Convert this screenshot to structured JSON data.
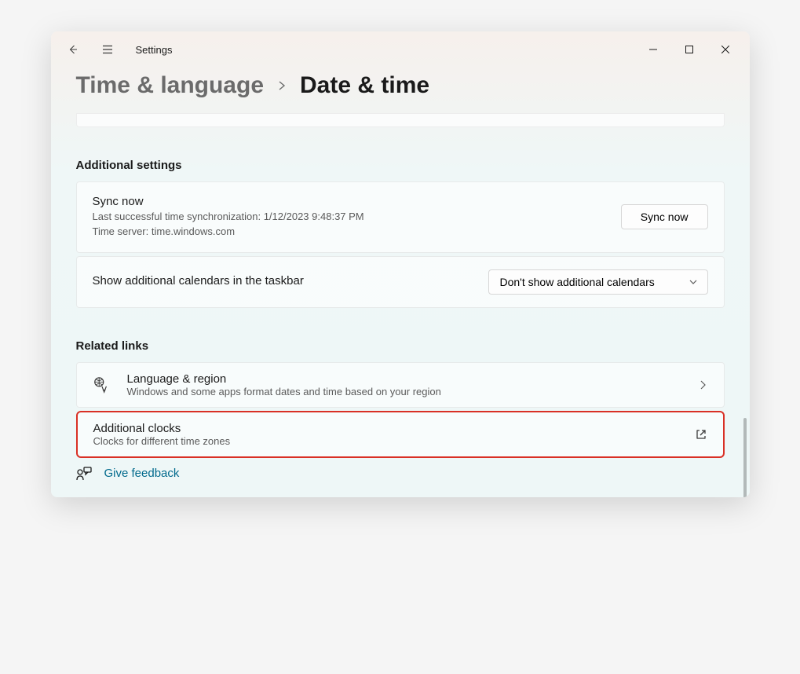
{
  "app": {
    "title": "Settings"
  },
  "breadcrumb": {
    "parent": "Time & language",
    "current": "Date & time"
  },
  "sections": {
    "additional_settings": {
      "heading": "Additional settings",
      "sync": {
        "title": "Sync now",
        "last_sync": "Last successful time synchronization: 1/12/2023 9:48:37 PM",
        "server": "Time server: time.windows.com",
        "button": "Sync now"
      },
      "calendars": {
        "label": "Show additional calendars in the taskbar",
        "selected": "Don't show additional calendars"
      }
    },
    "related_links": {
      "heading": "Related links",
      "language_region": {
        "title": "Language & region",
        "sub": "Windows and some apps format dates and time based on your region"
      },
      "additional_clocks": {
        "title": "Additional clocks",
        "sub": "Clocks for different time zones"
      }
    },
    "feedback": {
      "label": "Give feedback"
    }
  }
}
